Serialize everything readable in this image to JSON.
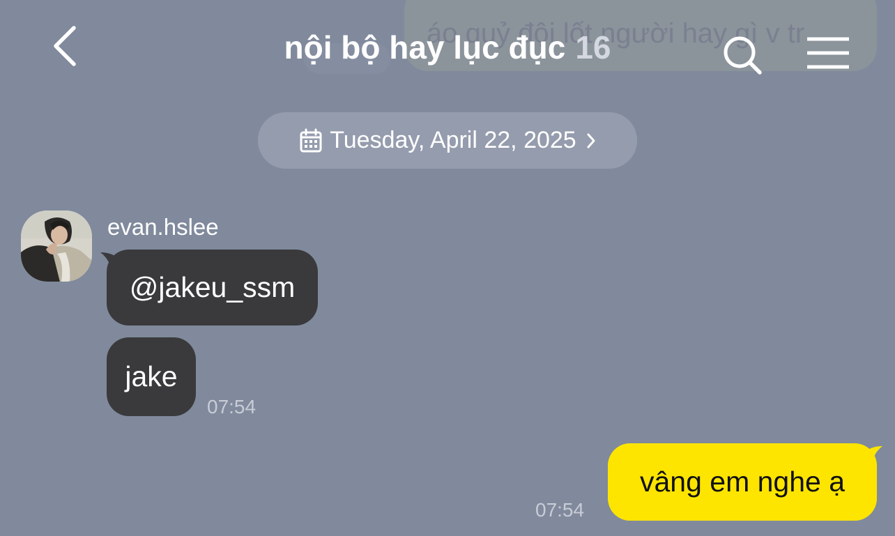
{
  "header": {
    "title": "nội bộ hay lục đục",
    "member_count": "16",
    "ghost_overlay_text": "áo quỷ đội lốt người hay gì v tr"
  },
  "date_separator": {
    "label": "Tuesday, April 22, 2025"
  },
  "messages": [
    {
      "sender": "evan.hslee",
      "text": "@jakeu_ssm",
      "side": "left"
    },
    {
      "sender": "evan.hslee",
      "text": "jake",
      "time": "07:54",
      "side": "left"
    },
    {
      "text": "vâng em nghe ạ",
      "time": "07:54",
      "side": "right"
    }
  ],
  "icons": {
    "back": "chevron-left-icon",
    "search": "search-icon",
    "menu": "hamburger-menu-icon",
    "calendar": "calendar-icon",
    "chevron": "chevron-right-icon"
  },
  "colors": {
    "background": "#808a9c",
    "incoming_bubble": "#3a3a3c",
    "outgoing_bubble": "#fee500",
    "date_pill": "#959cad"
  }
}
